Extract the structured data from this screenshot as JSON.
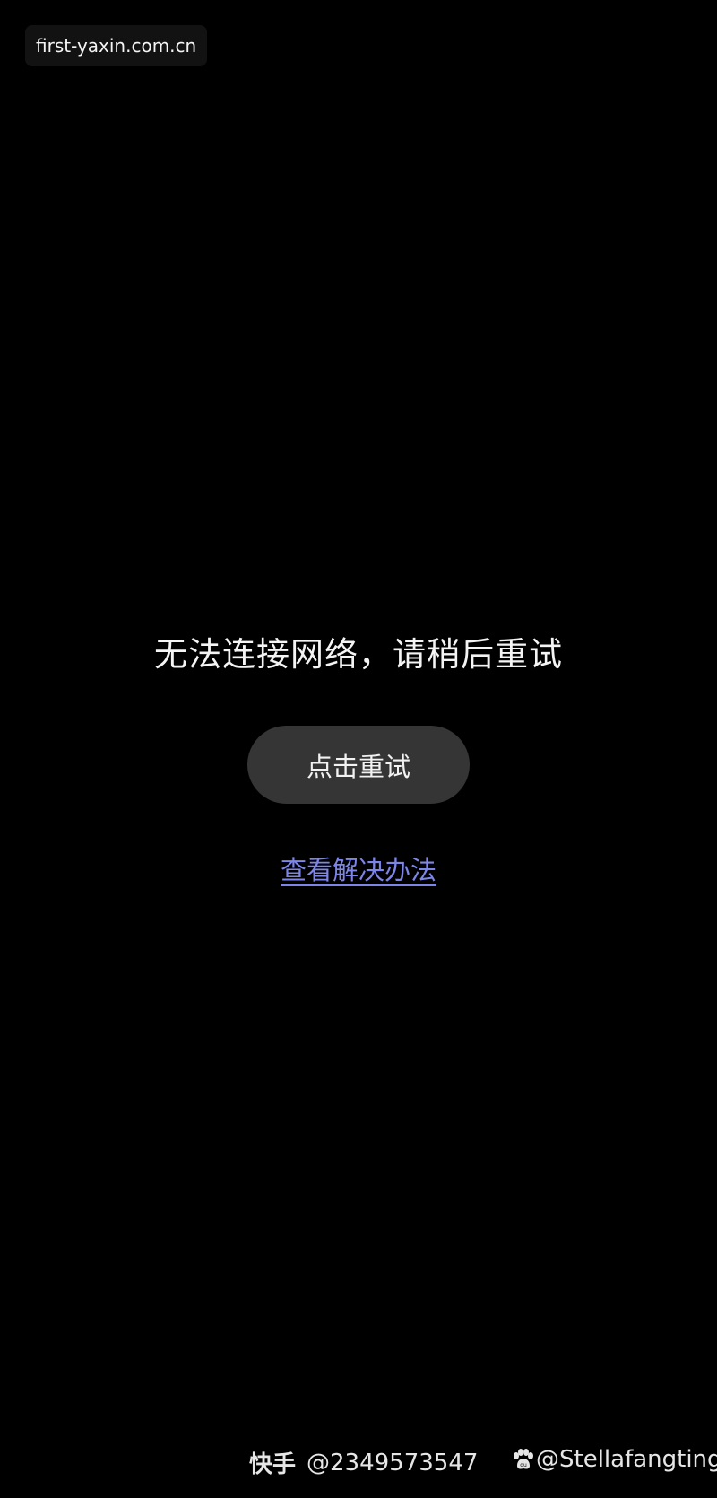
{
  "url_bar": {
    "text": "first-yaxin.com.cn"
  },
  "error": {
    "message": "无法连接网络，请稍后重试",
    "retry_label": "点击重试",
    "solution_link": "查看解决办法"
  },
  "watermarks": {
    "kuaishou_brand": "快手",
    "kuaishou_handle": "@2349573547",
    "baidu_icon": "paw-icon",
    "baidu_handle": "@Stellafangting"
  },
  "colors": {
    "background": "#000000",
    "button_bg": "#353535",
    "link": "#7d85e8",
    "text": "#f4f4f4"
  }
}
